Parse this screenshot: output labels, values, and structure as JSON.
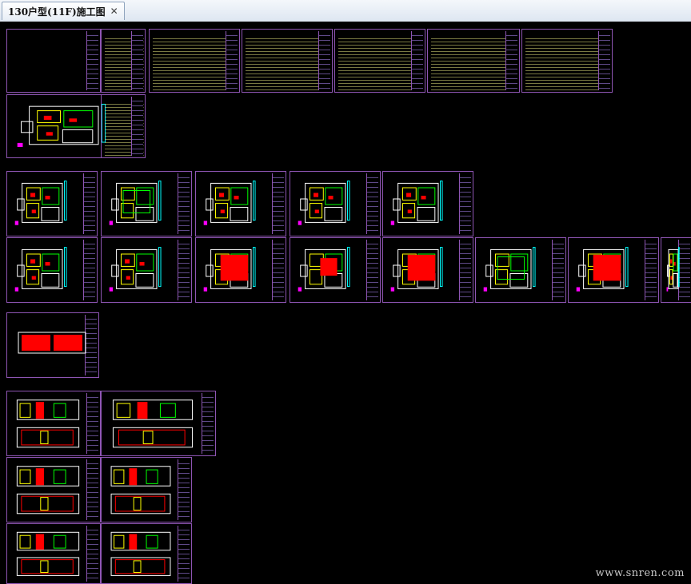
{
  "tab": {
    "title": "130户型(11F)施工图",
    "close_icon": "close-icon"
  },
  "canvas": {
    "background": "#000000",
    "frame_color": "#8e55b3",
    "plan_colors": [
      "#ff0000",
      "#ffff00",
      "#00ff00",
      "#ffffff",
      "#ff00ff",
      "#00ffff"
    ]
  },
  "watermark": "www.snren.com"
}
